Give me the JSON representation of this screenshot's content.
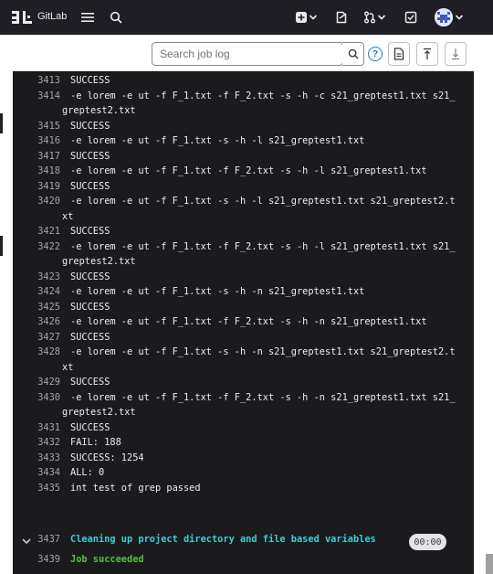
{
  "topbar": {
    "brand": "GitLab",
    "icons": [
      "gitlab-logo",
      "hamburger-icon",
      "search-icon",
      "plus-icon",
      "chevron-down-icon",
      "issues-icon",
      "merge-request-icon",
      "todo-icon",
      "avatar"
    ]
  },
  "toolbar": {
    "search_placeholder": "Search job log",
    "help_label": "?"
  },
  "log": {
    "lines": [
      {
        "num": "3413",
        "text": "SUCCESS"
      },
      {
        "num": "3414",
        "text": "-e lorem -e ut -f F_1.txt -f F_2.txt -s -h -c s21_greptest1.txt s21_",
        "cont": "greptest2.txt"
      },
      {
        "num": "3415",
        "text": "SUCCESS"
      },
      {
        "num": "3416",
        "text": "-e lorem -e ut -f F_1.txt -s -h -l s21_greptest1.txt"
      },
      {
        "num": "3417",
        "text": "SUCCESS"
      },
      {
        "num": "3418",
        "text": "-e lorem -e ut -f F_1.txt -f F_2.txt -s -h -l s21_greptest1.txt"
      },
      {
        "num": "3419",
        "text": "SUCCESS"
      },
      {
        "num": "3420",
        "text": "-e lorem -e ut -f F_1.txt -s -h -l s21_greptest1.txt s21_greptest2.t",
        "cont": "xt"
      },
      {
        "num": "3421",
        "text": "SUCCESS"
      },
      {
        "num": "3422",
        "text": "-e lorem -e ut -f F_1.txt -f F_2.txt -s -h -l s21_greptest1.txt s21_",
        "cont": "greptest2.txt"
      },
      {
        "num": "3423",
        "text": "SUCCESS"
      },
      {
        "num": "3424",
        "text": "-e lorem -e ut -f F_1.txt -s -h -n s21_greptest1.txt"
      },
      {
        "num": "3425",
        "text": "SUCCESS"
      },
      {
        "num": "3426",
        "text": "-e lorem -e ut -f F_1.txt -f F_2.txt -s -h -n s21_greptest1.txt"
      },
      {
        "num": "3427",
        "text": "SUCCESS"
      },
      {
        "num": "3428",
        "text": "-e lorem -e ut -f F_1.txt -s -h -n s21_greptest1.txt s21_greptest2.t",
        "cont": "xt"
      },
      {
        "num": "3429",
        "text": "SUCCESS"
      },
      {
        "num": "3430",
        "text": "-e lorem -e ut -f F_1.txt -f F_2.txt -s -h -n s21_greptest1.txt s21_",
        "cont": "greptest2.txt"
      },
      {
        "num": "3431",
        "text": "SUCCESS"
      },
      {
        "num": "3432",
        "text": "FAIL: 188"
      },
      {
        "num": "3433",
        "text": "SUCCESS: 1254"
      },
      {
        "num": "3434",
        "text": "ALL: 0"
      },
      {
        "num": "3435",
        "text": "int test of grep passed"
      }
    ],
    "section_line": {
      "num": "3437",
      "text": "Cleaning up project directory and file based variables"
    },
    "final_line": {
      "num": "3439",
      "text": "Job succeeded"
    },
    "duration": "00:00"
  },
  "colors": {
    "topbar_bg": "#1f1e24",
    "log_bg": "#1b1b1e",
    "section_text": "#3ccfcf",
    "success_text": "#52c13a",
    "link_blue": "#1f75cb"
  }
}
